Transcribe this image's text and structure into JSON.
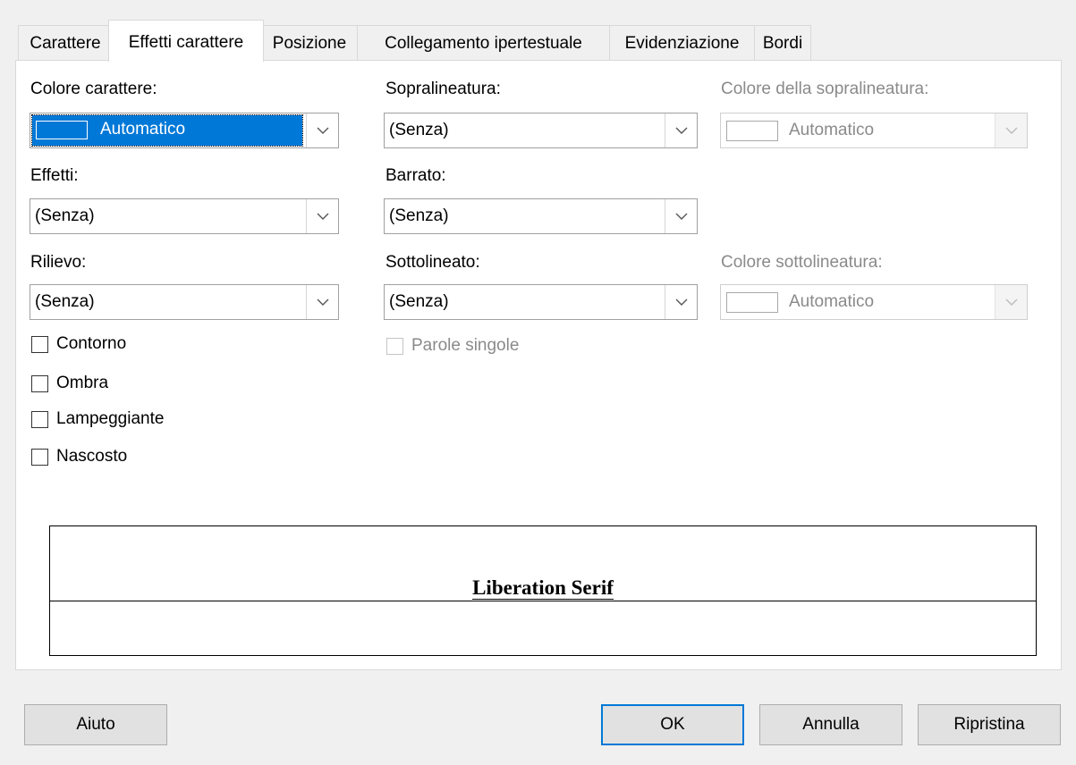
{
  "tabs": [
    {
      "label": "Carattere",
      "active": false
    },
    {
      "label": "Effetti carattere",
      "active": true
    },
    {
      "label": "Posizione",
      "active": false
    },
    {
      "label": "Collegamento ipertestuale",
      "active": false
    },
    {
      "label": "Evidenziazione",
      "active": false
    },
    {
      "label": "Bordi",
      "active": false
    }
  ],
  "font_color": {
    "label": "Colore carattere:",
    "value": "Automatico"
  },
  "effects": {
    "label": "Effetti:",
    "value": "(Senza)"
  },
  "relief": {
    "label": "Rilievo:",
    "value": "(Senza)"
  },
  "overline": {
    "label": "Sopralineatura:",
    "value": "(Senza)"
  },
  "strikethrough": {
    "label": "Barrato:",
    "value": "(Senza)"
  },
  "underline": {
    "label": "Sottolineato:",
    "value": "(Senza)"
  },
  "overline_color": {
    "label": "Colore della sopralineatura:",
    "value": "Automatico",
    "enabled": false
  },
  "underline_color": {
    "label": "Colore sottolineatura:",
    "value": "Automatico",
    "enabled": false
  },
  "checkboxes": {
    "outline": {
      "label": "Contorno",
      "checked": false
    },
    "shadow": {
      "label": "Ombra",
      "checked": false
    },
    "blinking": {
      "label": "Lampeggiante",
      "checked": false
    },
    "hidden": {
      "label": "Nascosto",
      "checked": false
    },
    "individual_words": {
      "label": "Parole singole",
      "checked": false,
      "enabled": false
    }
  },
  "preview": {
    "text": "Liberation Serif"
  },
  "buttons": {
    "help": "Aiuto",
    "ok": "OK",
    "cancel": "Annulla",
    "reset": "Ripristina"
  },
  "colors": {
    "accent": "#0078d7",
    "disabled_text": "#8a8a8a"
  }
}
